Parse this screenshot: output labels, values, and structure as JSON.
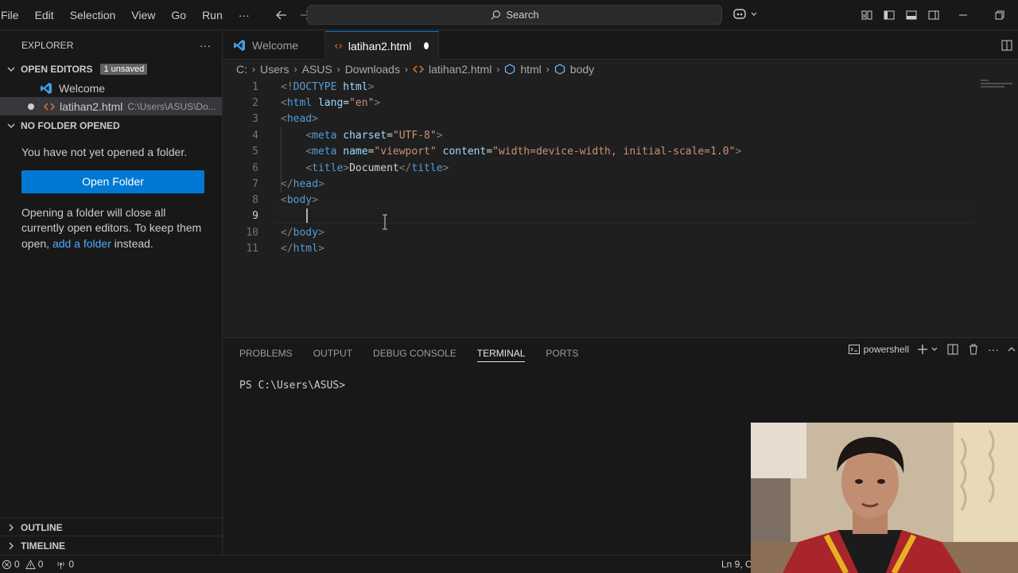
{
  "menu": [
    "File",
    "Edit",
    "Selection",
    "View",
    "Go",
    "Run",
    "···"
  ],
  "search": {
    "label": "Search"
  },
  "sidebar": {
    "title": "EXPLORER",
    "more": "···",
    "open_editors": {
      "label": "OPEN EDITORS",
      "badge": "1 unsaved"
    },
    "open_files": [
      {
        "name": "Welcome",
        "path": ""
      },
      {
        "name": "latihan2.html",
        "path": "C:\\Users\\ASUS\\Do..."
      }
    ],
    "no_folder": {
      "label": "NO FOLDER OPENED",
      "message": "You have not yet opened a folder.",
      "button": "Open Folder",
      "hint_prefix": "Opening a folder will close all currently open editors. To keep them open, ",
      "hint_link": "add a folder",
      "hint_suffix": " instead."
    },
    "outline": "OUTLINE",
    "timeline": "TIMELINE"
  },
  "tabs": [
    {
      "label": "Welcome"
    },
    {
      "label": "latihan2.html"
    }
  ],
  "breadcrumb": [
    "C:",
    "Users",
    "ASUS",
    "Downloads",
    "latihan2.html",
    "html",
    "body"
  ],
  "editor": {
    "line_numbers": [
      "1",
      "2",
      "3",
      "4",
      "5",
      "6",
      "7",
      "8",
      "9",
      "10",
      "11"
    ],
    "current_line": 9
  },
  "panel": {
    "tabs": [
      "PROBLEMS",
      "OUTPUT",
      "DEBUG CONSOLE",
      "TERMINAL",
      "PORTS"
    ],
    "active_tab": "TERMINAL",
    "shell": "powershell",
    "prompt": "PS C:\\Users\\ASUS>"
  },
  "status": {
    "errors": "0",
    "warnings": "0",
    "ports": "0",
    "position": "Ln 9, C"
  },
  "colors": {
    "accent": "#0078d4",
    "link": "#4daafc"
  }
}
